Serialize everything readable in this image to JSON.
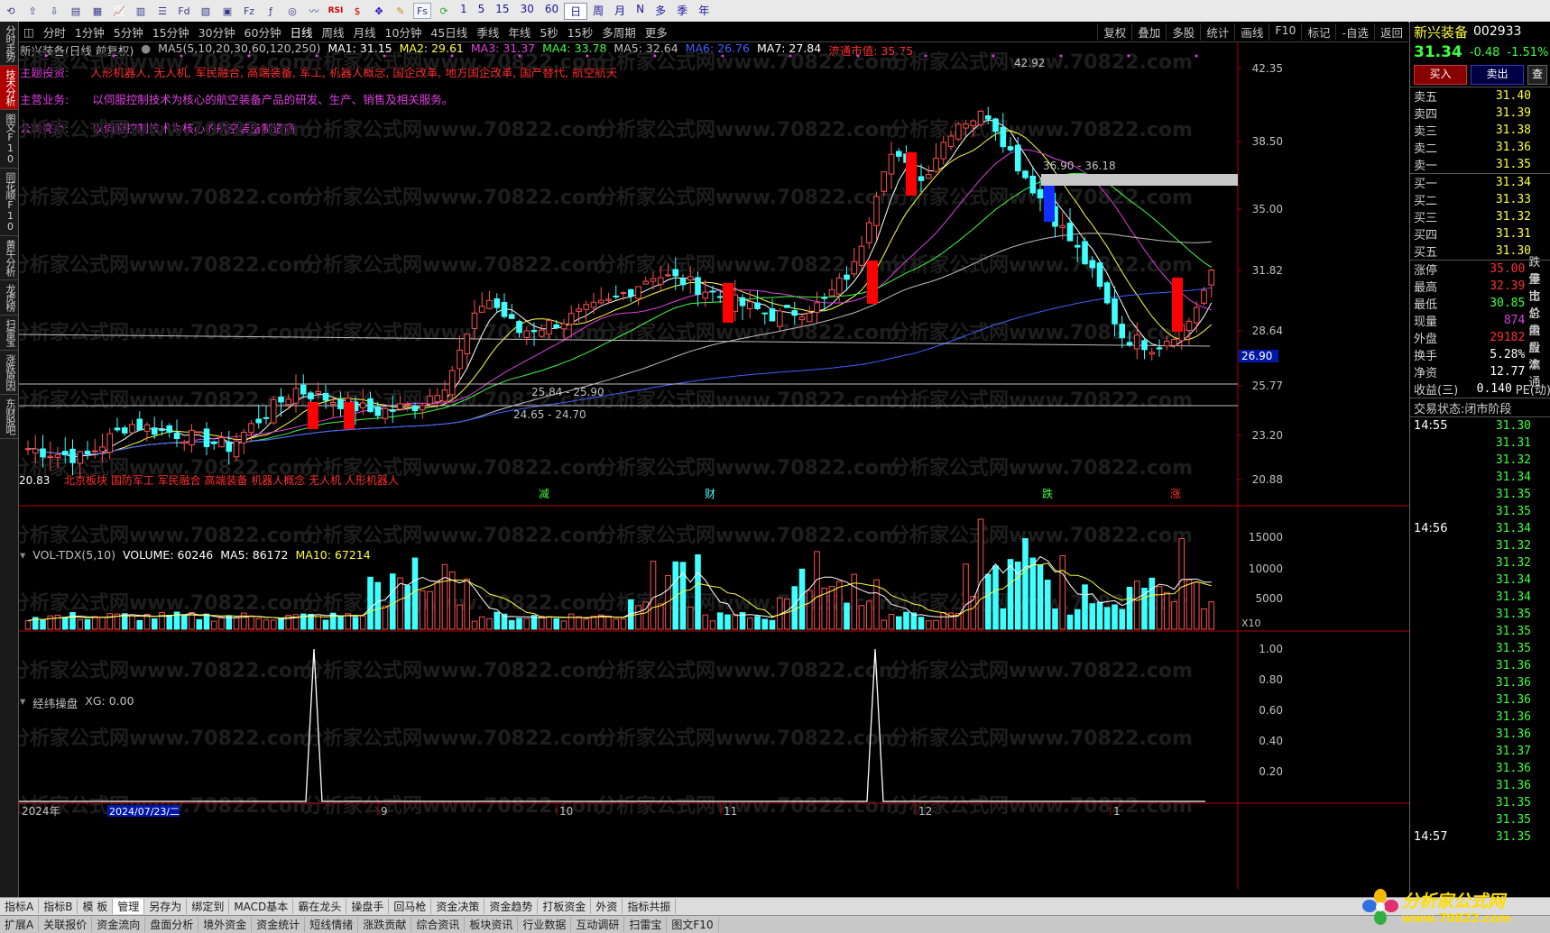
{
  "toolbar": {
    "periods": [
      "1",
      "5",
      "15",
      "30",
      "60",
      "日",
      "周",
      "月",
      "N",
      "多",
      "季",
      "年"
    ]
  },
  "leftbar": [
    "分时走势",
    "技术分析",
    "图文F10",
    "同花顺F10",
    "黄牛分析",
    "龙虎榜",
    "扫雷宝",
    "涨跌原因",
    "东财股吧"
  ],
  "periodbar": {
    "items": [
      "分时",
      "1分钟",
      "5分钟",
      "15分钟",
      "30分钟",
      "60分钟",
      "日线",
      "周线",
      "月线",
      "10分钟",
      "45日线",
      "季线",
      "年线",
      "5秒",
      "15秒",
      "多周期",
      "更多"
    ],
    "active": "日线",
    "right": [
      "复权",
      "叠加",
      "多股",
      "统计",
      "画线",
      "F10",
      "标记",
      "-自选",
      "返回"
    ]
  },
  "stock": {
    "name": "新兴装备",
    "code": "002933",
    "header": "新兴装备(日线 前复权)",
    "price": "31.34",
    "change": "-0.48",
    "change_pct": "-1.51%"
  },
  "ma_legend": [
    {
      "text": "MA5(5,10,20,30,60,120,250)",
      "color": "#c0c0c0"
    },
    {
      "text": "MA1: 31.15",
      "color": "#ffffff"
    },
    {
      "text": "MA2: 29.61",
      "color": "#ffff40"
    },
    {
      "text": "MA3: 31.37",
      "color": "#e040e0"
    },
    {
      "text": "MA4: 33.78",
      "color": "#40ff40"
    },
    {
      "text": "MA5: 32.64",
      "color": "#c0c0c0"
    },
    {
      "text": "MA6: 26.76",
      "color": "#4060ff"
    },
    {
      "text": "MA7: 27.84",
      "color": "#ffffff"
    },
    {
      "text": "流通市值: 35.75",
      "color": "#ff3030"
    }
  ],
  "info": {
    "theme_label": "主题投资:",
    "theme_text": "人形机器人, 无人机, 军民融合, 高端装备, 军工, 机器人概念, 国企改革, 地方国企改革, 国产替代, 航空航天",
    "business_label": "主营业务:",
    "business_text": "以伺服控制技术为核心的航空装备产品的研发、生产、销售及相关服务。",
    "highlight_label": "公司亮点:",
    "highlight_text": "以伺服控制技术为核心的航空装备制造商"
  },
  "main_chart": {
    "yticks": [
      "42.35",
      "38.50",
      "35.00",
      "31.82",
      "28.64",
      "25.77",
      "23.20",
      "20.88"
    ],
    "price_tag": "26.90",
    "annotations": {
      "high": "42.92",
      "range1": "36.90 - 36.18",
      "range2": "25.84 - 25.90",
      "range3": "24.65 - 24.70",
      "low": "20.83"
    },
    "bottom_text": "北京板块 国防军工 军民融合 高端装备 机器人概念 无人机 人形机器人",
    "markers": [
      "减",
      "财",
      "跌",
      "涨"
    ]
  },
  "volume": {
    "legend": [
      {
        "text": "VOL-TDX(5,10)",
        "color": "#c0c0c0"
      },
      {
        "text": "VOLUME: 60246",
        "color": "#ffffff"
      },
      {
        "text": "MA5: 86172",
        "color": "#ffffff"
      },
      {
        "text": "MA10: 67214",
        "color": "#ffff40"
      }
    ],
    "yticks": [
      "15000",
      "10000",
      "5000"
    ],
    "unit": "X10"
  },
  "indicator": {
    "name": "经纬操盘",
    "legend": "XG: 0.00",
    "yticks": [
      "1.00",
      "0.80",
      "0.60",
      "0.40",
      "0.20"
    ]
  },
  "xaxis": {
    "labels": [
      "2024年",
      "9",
      "10",
      "11",
      "12",
      "1"
    ],
    "date_tag": "2024/07/23/二"
  },
  "bottom_tabs": [
    "指标A",
    "指标B",
    "模 板",
    "管理",
    "另存为",
    "绑定到",
    "MACD基本",
    "霸在龙头",
    "操盘手",
    "回马枪",
    "资金决策",
    "资金趋势",
    "打板资金",
    "外资",
    "指标共振"
  ],
  "bottom_tabs2": [
    "扩展A",
    "关联报价",
    "资金流向",
    "盘面分析",
    "境外资金",
    "资金统计",
    "短线情绪",
    "涨跌贡献",
    "综合资讯",
    "板块资讯",
    "行业数据",
    "互动调研",
    "扫雷宝",
    "图文F10"
  ],
  "quote": {
    "buy_label": "买入",
    "sell_label": "卖出",
    "more_label": "查",
    "asks": [
      {
        "label": "卖五",
        "price": "31.40"
      },
      {
        "label": "卖四",
        "price": "31.39"
      },
      {
        "label": "卖三",
        "price": "31.38"
      },
      {
        "label": "卖二",
        "price": "31.36"
      },
      {
        "label": "卖一",
        "price": "31.35"
      }
    ],
    "bids": [
      {
        "label": "买一",
        "price": "31.34"
      },
      {
        "label": "买二",
        "price": "31.33"
      },
      {
        "label": "买三",
        "price": "31.32"
      },
      {
        "label": "买四",
        "price": "31.31"
      },
      {
        "label": "买五",
        "price": "31.30"
      }
    ],
    "stats": [
      {
        "label": "涨停",
        "value": "35.00",
        "color": "#ff3030",
        "extra": "跌停"
      },
      {
        "label": "最高",
        "value": "32.39",
        "color": "#ff3030",
        "extra": "量比"
      },
      {
        "label": "最低",
        "value": "30.85",
        "color": "#40ff40",
        "extra": "市价"
      },
      {
        "label": "现量",
        "value": "874",
        "color": "#e040e0",
        "extra": "总量"
      },
      {
        "label": "外盘",
        "value": "29182",
        "color": "#ff3030",
        "extra": "内盘"
      },
      {
        "label": "换手",
        "value": "5.28%",
        "color": "#ffffff",
        "extra": "股本"
      },
      {
        "label": "净资",
        "value": "12.77",
        "color": "#ffffff",
        "extra": "流通"
      },
      {
        "label": "收益(三)",
        "value": "0.140",
        "color": "#ffffff",
        "extra": "PE(动)"
      }
    ],
    "status_label": "交易状态:",
    "status_value": "闭市阶段",
    "ticks": [
      {
        "time": "14:55",
        "price": "31.30"
      },
      {
        "time": "",
        "price": "31.31"
      },
      {
        "time": "",
        "price": "31.32"
      },
      {
        "time": "",
        "price": "31.34"
      },
      {
        "time": "",
        "price": "31.35"
      },
      {
        "time": "",
        "price": "31.35"
      },
      {
        "time": "14:56",
        "price": "31.34"
      },
      {
        "time": "",
        "price": "31.32"
      },
      {
        "time": "",
        "price": "31.32"
      },
      {
        "time": "",
        "price": "31.34"
      },
      {
        "time": "",
        "price": "31.34"
      },
      {
        "time": "",
        "price": "31.35"
      },
      {
        "time": "",
        "price": "31.35"
      },
      {
        "time": "",
        "price": "31.35"
      },
      {
        "time": "",
        "price": "31.36"
      },
      {
        "time": "",
        "price": "31.36"
      },
      {
        "time": "",
        "price": "31.36"
      },
      {
        "time": "",
        "price": "31.36"
      },
      {
        "time": "",
        "price": "31.36"
      },
      {
        "time": "",
        "price": "31.37"
      },
      {
        "time": "",
        "price": "31.36"
      },
      {
        "time": "",
        "price": "31.36"
      },
      {
        "time": "",
        "price": "31.35"
      },
      {
        "time": "",
        "price": "31.35"
      },
      {
        "time": "14:57",
        "price": "31.35"
      }
    ]
  },
  "watermark": "分析家公式网www.70822.com",
  "logo": {
    "text": "分析家公式网",
    "url": "www.70822.com"
  }
}
